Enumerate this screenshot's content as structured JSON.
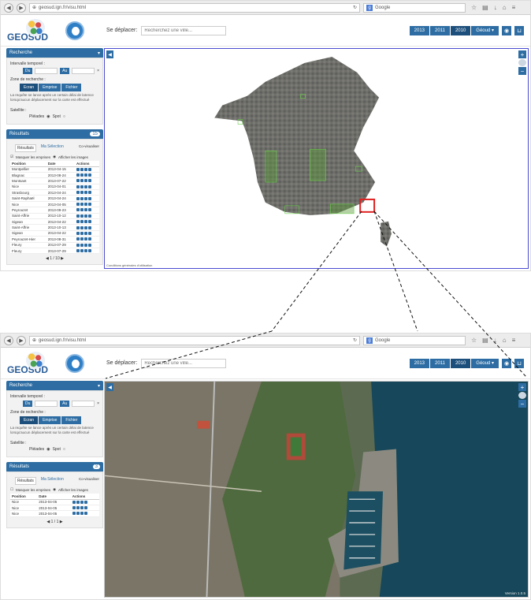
{
  "browser": {
    "url": "geosud.ign.fr/visu.html",
    "search_engine": "Google",
    "back_icon": "back-arrow-icon",
    "forward_icon": "forward-arrow-icon"
  },
  "header": {
    "logo_text": "GEOSUD",
    "move_label": "Se déplacer:",
    "search_placeholder": "Recherchez une ville...",
    "years": [
      "2013",
      "2011",
      "2010"
    ],
    "active_year": "2010",
    "user_menu": "Géoud ▾"
  },
  "sidebar": {
    "search_title": "Recherche",
    "time_interval_label": "Intervalle temporel :",
    "from_label": "Du",
    "to_label": "Au",
    "zone_label": "Zone de recherche :",
    "zone_options": [
      "Ecran",
      "Emprise",
      "Fichier"
    ],
    "active_zone": "Ecran",
    "zone_note": "La requête se lance après un certain délai de latence lorsqu'aucun déplacement sur la carte est effectué",
    "satellite_label": "Satellite :",
    "satellite_options": [
      "Pléiades",
      "Spot"
    ],
    "results_title": "Résultats",
    "tab_results": "Résultats",
    "tab_selection": "Ma Sélection",
    "co_visualise": "Co-visualiser",
    "mask_label": "Masquer les emprises",
    "show_images_label": "Afficher les images",
    "columns": [
      "Position",
      "Date",
      "Actions"
    ]
  },
  "shot1": {
    "results_count": "15",
    "rows": [
      [
        "Montpellier",
        "2013-04-15"
      ],
      [
        "Blagnac",
        "2013-08-24"
      ],
      [
        "Montsant",
        "2013-07-22"
      ],
      [
        "Nice",
        "2013-04-01"
      ],
      [
        "Strasbourg",
        "2013-04-24"
      ],
      [
        "Saint-Raphaël",
        "2013-04-24"
      ],
      [
        "Nice",
        "2013-04-05"
      ],
      [
        "Peyrouzet",
        "2013-09-23"
      ],
      [
        "Saint-Affrie",
        "2013-10-12"
      ],
      [
        "Sigean",
        "2013-04-22"
      ],
      [
        "Saint-Affrie",
        "2013-10-13"
      ],
      [
        "Sigean",
        "2013-04-22"
      ],
      [
        "Peyrouzet-Hier",
        "2013-08-31"
      ],
      [
        "Fleury",
        "2013-07-29"
      ],
      [
        "Fleury",
        "2013-07-29"
      ]
    ],
    "pager": "1 / 10",
    "footnote": "Conditions générales d'utilisation"
  },
  "shot2": {
    "results_count": "3",
    "rows": [
      [
        "Nice",
        "2013-04-05"
      ],
      [
        "Nice",
        "2013-04-05"
      ],
      [
        "Nice",
        "2013-04-05"
      ]
    ],
    "pager": "1 / 1",
    "version": "Version 1.0.5"
  }
}
